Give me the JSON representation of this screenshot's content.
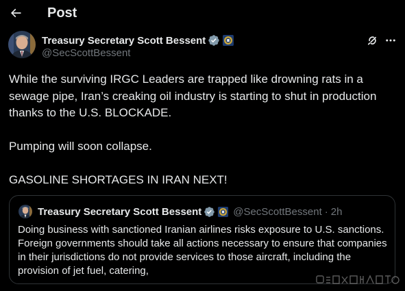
{
  "header": {
    "title": "Post",
    "back_icon": "arrow-left-icon"
  },
  "author": {
    "name": "Treasury Secretary Scott Bessent",
    "handle": "@SecScottBessent",
    "verified_icon": "verified-gray-badge-icon",
    "affiliation_icon": "treasury-seal-icon"
  },
  "actions": {
    "grok_icon": "grok-icon",
    "more_icon": "more-horizontal-icon"
  },
  "tweet": {
    "line1": "While the surviving IRGC Leaders are trapped like drowning rats in a sewage pipe, Iran’s creaking oil industry is starting to shut in production thanks to the U.S. BLOCKADE.",
    "line2": "Pumping will soon collapse.",
    "line3": "GASOLINE SHORTAGES IN IRAN NEXT!"
  },
  "quote": {
    "name": "Treasury Secretary Scott Bessent",
    "handle": "@SecScottBessent",
    "separator": "·",
    "time": "2h",
    "text": "Doing business with sanctioned Iranian airlines risks exposure to U.S. sanctions.  Foreign governments should take all actions necessary to ensure that companies in their jurisdictions do not provide services to those aircraft, including the provision of jet fuel, catering,"
  },
  "colors": {
    "background": "#000000",
    "text_primary": "#e7e9ea",
    "text_secondary": "#71767b",
    "border": "#2f3336",
    "verified_badge": "#829aab"
  }
}
